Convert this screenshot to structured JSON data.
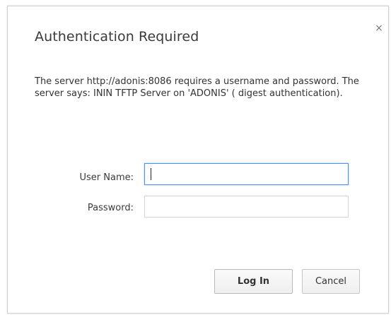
{
  "dialog": {
    "title": "Authentication Required",
    "close_symbol": "×",
    "message": "The server http://adonis:8086 requires a username and password. The server says: ININ TFTP Server on 'ADONIS' ( digest authentication).",
    "fields": {
      "username_label": "User Name:",
      "username_value": "",
      "password_label": "Password:",
      "password_value": ""
    },
    "buttons": {
      "login_label": "Log In",
      "cancel_label": "Cancel"
    }
  },
  "icons": {
    "close": "close-icon"
  },
  "colors": {
    "focus_border": "#4d90fe",
    "dialog_border": "#cfcfcf",
    "text": "#333333"
  }
}
